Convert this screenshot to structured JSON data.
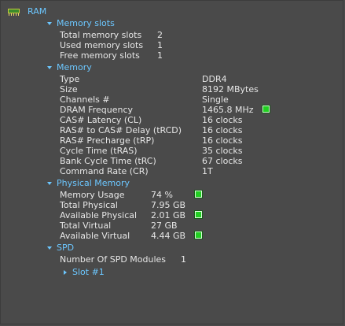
{
  "root": {
    "label": "RAM",
    "icon": "ram-module-icon"
  },
  "sections": {
    "memory_slots": {
      "title": "Memory slots",
      "rows": [
        {
          "label": "Total memory slots",
          "value": "2"
        },
        {
          "label": "Used memory slots",
          "value": "1"
        },
        {
          "label": "Free memory slots",
          "value": "1"
        }
      ]
    },
    "memory": {
      "title": "Memory",
      "rows": [
        {
          "label": "Type",
          "value": "DDR4"
        },
        {
          "label": "Size",
          "value": "8192 MBytes"
        },
        {
          "label": "Channels #",
          "value": "Single"
        },
        {
          "label": "DRAM Frequency",
          "value": "1465.8 MHz"
        },
        {
          "label": "CAS# Latency (CL)",
          "value": "16 clocks"
        },
        {
          "label": "RAS# to CAS# Delay (tRCD)",
          "value": "16 clocks"
        },
        {
          "label": "RAS# Precharge (tRP)",
          "value": "16 clocks"
        },
        {
          "label": "Cycle Time (tRAS)",
          "value": "35 clocks"
        },
        {
          "label": "Bank Cycle Time (tRC)",
          "value": "67 clocks"
        },
        {
          "label": "Command Rate (CR)",
          "value": "1T"
        }
      ]
    },
    "physical_memory": {
      "title": "Physical Memory",
      "rows": [
        {
          "label": "Memory Usage",
          "value": "74 %"
        },
        {
          "label": "Total Physical",
          "value": "7.95 GB"
        },
        {
          "label": "Available Physical",
          "value": "2.01 GB"
        },
        {
          "label": "Total Virtual",
          "value": "27 GB"
        },
        {
          "label": "Available Virtual",
          "value": "4.44 GB"
        }
      ]
    },
    "spd": {
      "title": "SPD",
      "rows": [
        {
          "label": "Number Of SPD Modules",
          "value": "1"
        }
      ],
      "slot_label": "Slot #1"
    }
  },
  "colors": {
    "background": "#4a4a4a",
    "text": "#e6e6e6",
    "accent": "#6cc7ff",
    "indicator": "#21d021"
  }
}
